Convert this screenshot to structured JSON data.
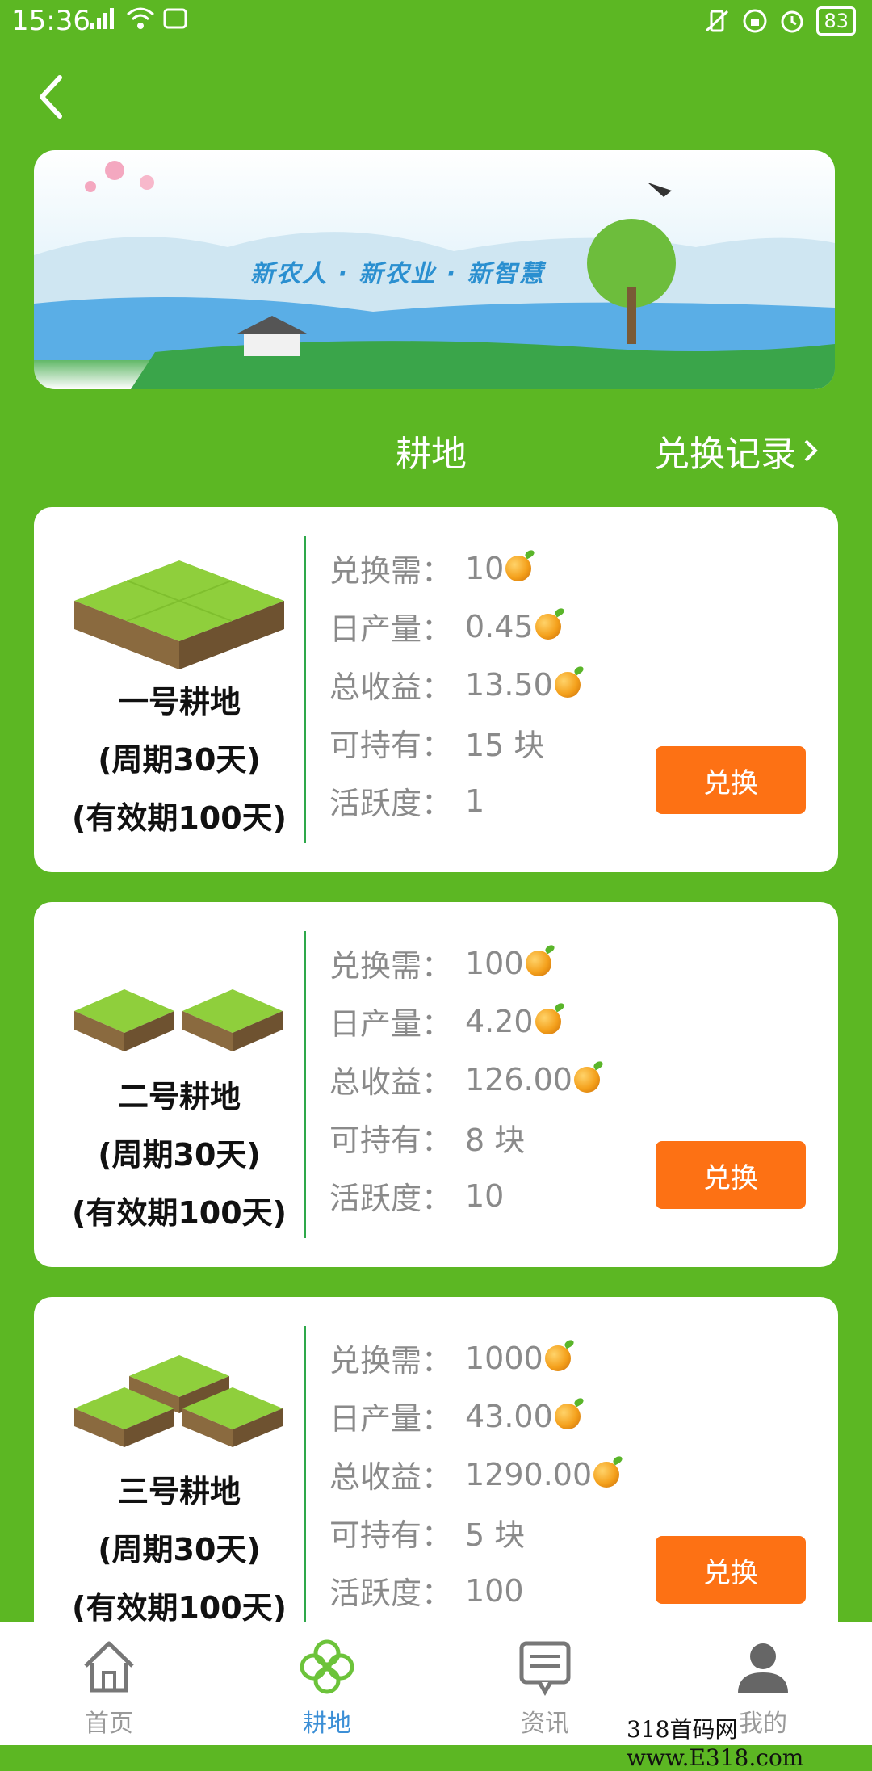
{
  "status_bar": {
    "time": "15:36",
    "battery": "83"
  },
  "banner": {
    "slogan": "新农人 · 新农业 · 新智慧"
  },
  "header": {
    "title": "耕地",
    "record_link": "兑换记录"
  },
  "labels": {
    "cost": "兑换需：",
    "daily": "日产量：",
    "total": "总收益：",
    "hold": "可持有：",
    "activity": "活跃度："
  },
  "cards": [
    {
      "name": "一号耕地",
      "period": "(周期30天)",
      "validity": "(有效期100天)",
      "cost": "10",
      "daily": "0.45",
      "total": "13.50",
      "hold": "15 块",
      "activity": "1",
      "button": "兑换"
    },
    {
      "name": "二号耕地",
      "period": "(周期30天)",
      "validity": "(有效期100天)",
      "cost": "100",
      "daily": "4.20",
      "total": "126.00",
      "hold": "8 块",
      "activity": "10",
      "button": "兑换"
    },
    {
      "name": "三号耕地",
      "period": "(周期30天)",
      "validity": "(有效期100天)",
      "cost": "1000",
      "daily": "43.00",
      "total": "1290.00",
      "hold": "5 块",
      "activity": "100",
      "button": "兑换"
    }
  ],
  "tabs": [
    {
      "label": "首页",
      "icon": "home-icon"
    },
    {
      "label": "耕地",
      "icon": "clover-icon"
    },
    {
      "label": "资讯",
      "icon": "news-icon"
    },
    {
      "label": "我的",
      "icon": "user-icon"
    }
  ],
  "active_tab": "耕地",
  "colors": {
    "background": "#5cb723",
    "button": "#fd7114",
    "active_tab": "#3c8fd6",
    "divider": "#2ea84a"
  },
  "watermark": "318首码网 www.E318.com"
}
